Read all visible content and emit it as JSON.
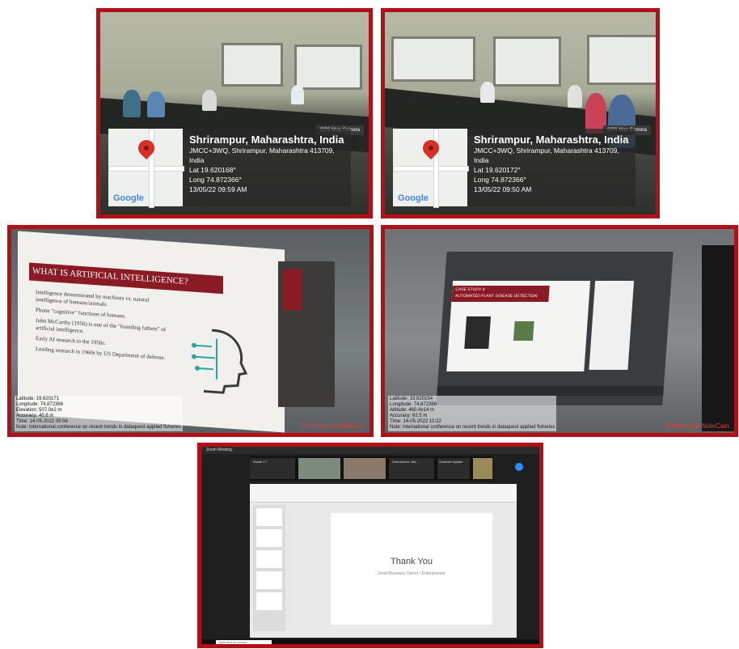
{
  "photos": {
    "top_left": {
      "place": "Shrirampur, Maharashtra, India",
      "address": "JMCC+3WQ, Shrirampur, Maharashtra 413709,",
      "country": "India",
      "lat": "Lat 19.620168°",
      "long": "Long 74.872366°",
      "datetime": "13/05/22 09:59 AM",
      "badge": "GPS Map Camera",
      "logo": "Google"
    },
    "top_right": {
      "place": "Shrirampur, Maharashtra, India",
      "address": "JMCC+3WQ, Shrirampur, Maharashtra 413709,",
      "country": "India",
      "lat": "Lat 19.620172°",
      "long": "Long 74.872366°",
      "datetime": "13/05/22 09:50 AM",
      "badge": "GPS Map Camera",
      "logo": "Google"
    },
    "mid_left": {
      "slide_title": "WHAT IS ARTIFICIAL INTELLIGENCE?",
      "bullets": [
        "Intelligence demonstrated by machines vs. natural intelligence of humans/animals.",
        "Phone \"cognitive\" functions of humans.",
        "John McCarthy (1956) is one of the \"founding fathers\" of artificial intelligence.",
        "Early AI research in the 1950s.",
        "Leading research in 1960s by US Department of defense."
      ],
      "notecam_lines": [
        "Latitude: 19.620171",
        "Longitude: 74.872366",
        "Elevation: 507.0±2 m",
        "Accuracy: 40.6 m",
        "Time: 14-05-2022 09:56",
        "Note: international conference on recent trends in dataquest applied fisheries"
      ],
      "powered": "Powered by NoteCam"
    },
    "mid_right": {
      "slide_title": "CASE STUDY 4:",
      "slide_subtitle": "AUTOMATED PLANT DISEASE DETECTION",
      "notecam_lines": [
        "Latitude: 19.620154",
        "Longitude: 74.872366",
        "Altitude: 460.4±14 m",
        "Accuracy: 82.5 m",
        "Time: 14-05-2022 10:22",
        "Note: international conference on recent trends in dataquest applied fisheries"
      ],
      "powered": "Powered by NoteCam"
    },
    "bottom": {
      "window_title": "Zoom Meeting",
      "participants": [
        "Sonali J.T",
        "Dhanashree Jha...",
        "Sudarshi Agham"
      ],
      "slide_title": "Thank You",
      "slide_subtitle": "Small Business Owner / Entrepreneur",
      "search_placeholder": "Type here to search"
    }
  },
  "colors": {
    "frame": "#b30f17",
    "pin": "#d93025",
    "slide_header": "#8a1a24"
  }
}
